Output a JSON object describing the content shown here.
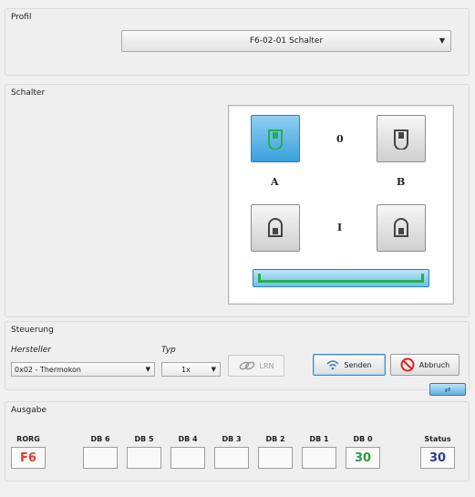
{
  "profil": {
    "title": "Profil",
    "selected": "F6-02-01 Schalter"
  },
  "schalter": {
    "title": "Schalter",
    "label_zero": "0",
    "label_one": "I",
    "label_a": "A",
    "label_b": "B",
    "active_rocker": "A0",
    "level_fraction": 1.0,
    "accent_color": "#3aa0dc",
    "level_color": "#22b14c"
  },
  "steuerung": {
    "title": "Steuerung",
    "hersteller_label": "Hersteller",
    "hersteller_value": "0x02 - Thermokon",
    "typ_label": "Typ",
    "typ_value": "1x",
    "lrn_label": "LRN",
    "senden_label": "Senden",
    "abbruch_label": "Abbruch"
  },
  "ausgabe": {
    "title": "Ausgabe",
    "columns": [
      "RORG",
      "DB 6",
      "DB 5",
      "DB 4",
      "DB 3",
      "DB 2",
      "DB 1",
      "DB 0",
      "Status"
    ],
    "values": [
      "F6",
      "",
      "",
      "",
      "",
      "",
      "",
      "30",
      "30"
    ],
    "rorg_color": "#e23b2e",
    "db0_color": "#2f9a3f",
    "status_color": "#2c3e8f"
  }
}
